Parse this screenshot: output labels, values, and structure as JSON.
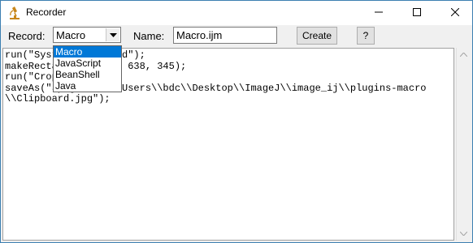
{
  "window": {
    "title": "Recorder"
  },
  "toolbar": {
    "record_label": "Record:",
    "record_value": "Macro",
    "name_label": "Name:",
    "name_value": "Macro.ijm",
    "create_label": "Create",
    "help_label": "?"
  },
  "dropdown": {
    "options": [
      "Macro",
      "JavaScript",
      "BeanShell",
      "Java"
    ],
    "selected": "Macro"
  },
  "editor": {
    "lines": [
      "run(\"System Clipboard\");",
      "makeRectangle(0, 59, 638, 345);",
      "run(\"Crop\");",
      "saveAs(\"Jpeg\", \"C:\\\\Users\\\\bdc\\\\Desktop\\\\ImageJ\\\\image_ij\\\\plugins-macro",
      "\\\\Clipboard.jpg\");"
    ]
  },
  "colors": {
    "accent": "#0078d7",
    "window_border": "#3c7fb1",
    "app_icon": "#c8861a"
  },
  "icons": {
    "app": "microscope-icon",
    "minimize": "minimize-icon",
    "maximize": "maximize-icon",
    "close": "close-icon",
    "combo": "chevron-down-icon"
  }
}
